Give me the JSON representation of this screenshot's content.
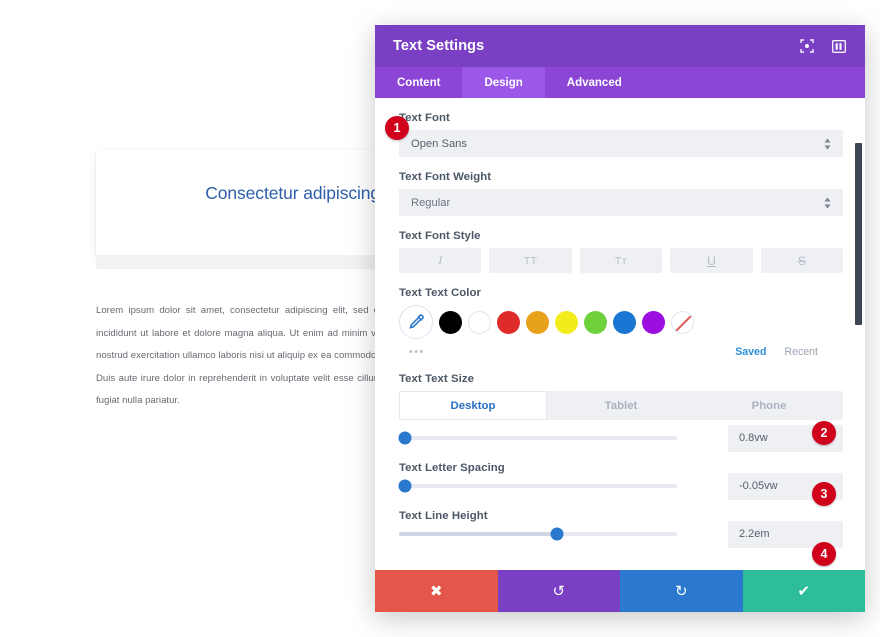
{
  "preview": {
    "heading": "Consectetur adipiscing elit",
    "body": "Lorem ipsum dolor sit amet, consectetur adipiscing elit, sed do eiusmod incididunt ut labore et dolore magna aliqua. Ut enim ad minim veniam, quis nostrud exercitation ullamco laboris nisi ut aliquip ex ea commodo consequat. Duis aute irure dolor in reprehenderit in voluptate velit esse cillum dolore eu fugiat nulla pariatur.",
    "heading_color": "#2f5fa8"
  },
  "modal": {
    "title": "Text Settings",
    "header_bg": "#7b3fc4",
    "tabs_bg": "#8b46d6",
    "header_icons": [
      {
        "name": "expand-icon",
        "glyph": "⬚"
      },
      {
        "name": "layout-columns-icon",
        "glyph": "▥"
      }
    ],
    "tabs": [
      {
        "label": "Content",
        "active": false
      },
      {
        "label": "Design",
        "active": true
      },
      {
        "label": "Advanced",
        "active": false
      }
    ]
  },
  "fields": {
    "text_font": {
      "label": "Text Font",
      "value": "Open Sans"
    },
    "text_font_weight": {
      "label": "Text Font Weight",
      "value": "Regular"
    },
    "text_font_style": {
      "label": "Text Font Style",
      "buttons": [
        {
          "name": "italic",
          "glyph": "I"
        },
        {
          "name": "uppercase",
          "glyph": "TT"
        },
        {
          "name": "capitalize",
          "glyph": "Tᴛ"
        },
        {
          "name": "underline",
          "glyph": "U"
        },
        {
          "name": "strikethrough",
          "glyph": "S"
        }
      ]
    },
    "text_text_color": {
      "label": "Text Text Color",
      "eyedropper": "eyedropper-icon",
      "more_dots": "•••",
      "swatches": [
        {
          "name": "black",
          "hex": "#000000"
        },
        {
          "name": "white",
          "hex": "#ffffff"
        },
        {
          "name": "red",
          "hex": "#e02b2b"
        },
        {
          "name": "orange",
          "hex": "#e8a11a"
        },
        {
          "name": "yellow",
          "hex": "#f2ec1c"
        },
        {
          "name": "green",
          "hex": "#6ed13c"
        },
        {
          "name": "blue",
          "hex": "#1976d2"
        },
        {
          "name": "purple",
          "hex": "#9b0ee0"
        },
        {
          "name": "none",
          "hex": "transparent"
        }
      ],
      "saved_label": "Saved",
      "recent_label": "Recent",
      "saved_color": "#2a8fd4"
    },
    "text_text_size": {
      "label": "Text Text Size",
      "devices": [
        {
          "label": "Desktop",
          "active": true
        },
        {
          "label": "Tablet",
          "active": false
        },
        {
          "label": "Phone",
          "active": false
        }
      ],
      "value": "0.8vw",
      "slider_percent": 2
    },
    "text_letter_spacing": {
      "label": "Text Letter Spacing",
      "value": "-0.05vw",
      "slider_percent": 2
    },
    "text_line_height": {
      "label": "Text Line Height",
      "value": "2.2em",
      "slider_percent": 57
    }
  },
  "footer": {
    "actions": [
      {
        "name": "cancel",
        "glyph": "✖",
        "color": "#e35649"
      },
      {
        "name": "undo",
        "glyph": "↺",
        "color": "#7b3fc4"
      },
      {
        "name": "redo",
        "glyph": "↻",
        "color": "#2a79cf"
      },
      {
        "name": "save",
        "glyph": "✔",
        "color": "#2dbd9a"
      }
    ]
  },
  "badges": {
    "one": "1",
    "two": "2",
    "three": "3",
    "four": "4",
    "color": "#d0021b"
  }
}
